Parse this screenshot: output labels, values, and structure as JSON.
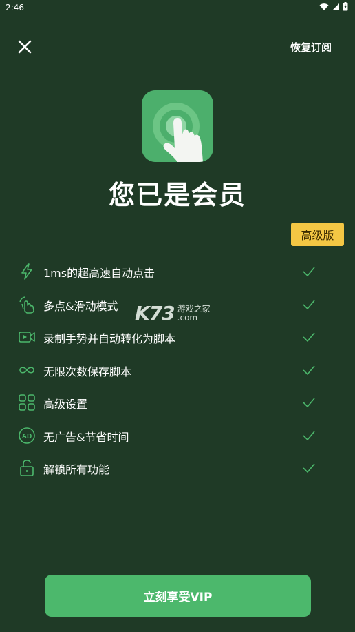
{
  "status": {
    "time": "2:46"
  },
  "header": {
    "restore_label": "恢复订阅"
  },
  "title": "您已是会员",
  "badge": "高级版",
  "features": [
    {
      "icon": "lightning-icon",
      "label": "1ms的超高速自动点击"
    },
    {
      "icon": "multi-tap-swipe-icon",
      "label": "多点&滑动模式"
    },
    {
      "icon": "video-record-icon",
      "label": "录制手势并自动转化为脚本"
    },
    {
      "icon": "infinity-icon",
      "label": "无限次数保存脚本"
    },
    {
      "icon": "grid-settings-icon",
      "label": "高级设置"
    },
    {
      "icon": "ad-free-icon",
      "label": "无广告&节省时间"
    },
    {
      "icon": "unlock-icon",
      "label": "解锁所有功能"
    }
  ],
  "cta_label": "立刻享受VIP",
  "watermark": {
    "brand": "K73",
    "site_cn": "游戏之家",
    "site_en": ".com"
  },
  "colors": {
    "background": "#1f3a26",
    "accent": "#4cb86c",
    "badge": "#f4c744"
  }
}
